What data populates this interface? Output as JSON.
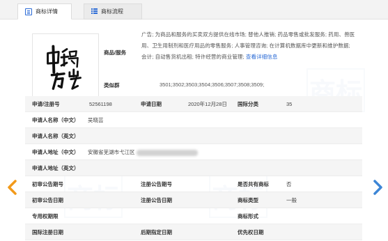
{
  "tabs": [
    {
      "label": "商标详情",
      "icon": "document-icon",
      "active": true
    },
    {
      "label": "商标流程",
      "icon": "list-icon",
      "active": false
    }
  ],
  "logo": {
    "alt_text": "中锅万岁"
  },
  "goods": {
    "label": "商品/服务",
    "text": "广告; 为商品和服务的买卖双方提供在线市场; 替他人推销; 药品零售或批发服务; 药用、兽医用、卫生用制剂和医疗用品的零售服务; 人事管理咨询; 在计算机数据库中更新和维护数据; 会计; 自动售货机出租; 特许经营的商业管理;",
    "link": "查看详细信息"
  },
  "similar_group": {
    "label": "类似群",
    "value": "3501;3502;3503;3504;3506;3507;3508;3509;"
  },
  "fields": {
    "reg_no_label": "申请/注册号",
    "reg_no": "52561198",
    "apply_date_label": "申请日期",
    "apply_date": "2020年12月28日",
    "class_label": "国际分类",
    "class": "35",
    "applicant_cn_label": "申请人名称（中文）",
    "applicant_cn": "吴晓芸",
    "applicant_en_label": "申请人名称（英文）",
    "applicant_en": "",
    "address_cn_label": "申请人地址（中文）",
    "address_cn": "安徽省芜湖市弋江区",
    "address_en_label": "申请人地址（英文）",
    "address_en": "",
    "prelim_no_label": "初审公告期号",
    "prelim_no": "",
    "reg_pub_no_label": "注册公告期号",
    "reg_pub_no": "",
    "shared_label": "是否共有商标",
    "shared": "否",
    "prelim_date_label": "初审公告日期",
    "prelim_date": "",
    "reg_pub_date_label": "注册公告日期",
    "reg_pub_date": "",
    "tm_type_label": "商标类型",
    "tm_type": "一般",
    "exclusive_label": "专用权期限",
    "exclusive": "",
    "tm_form_label": "商标形式",
    "tm_form": "",
    "intl_reg_label": "国际注册日期",
    "intl_reg": "",
    "later_label": "后期指定日期",
    "later": "",
    "priority_label": "优先权日期",
    "priority": ""
  },
  "colors": {
    "accent": "#2b6bd6",
    "arrow_left": "#f29a1a",
    "arrow_right": "#3d86d6"
  },
  "nav": {
    "prev_icon": "chevron-left-icon",
    "next_icon": "chevron-right-icon"
  }
}
